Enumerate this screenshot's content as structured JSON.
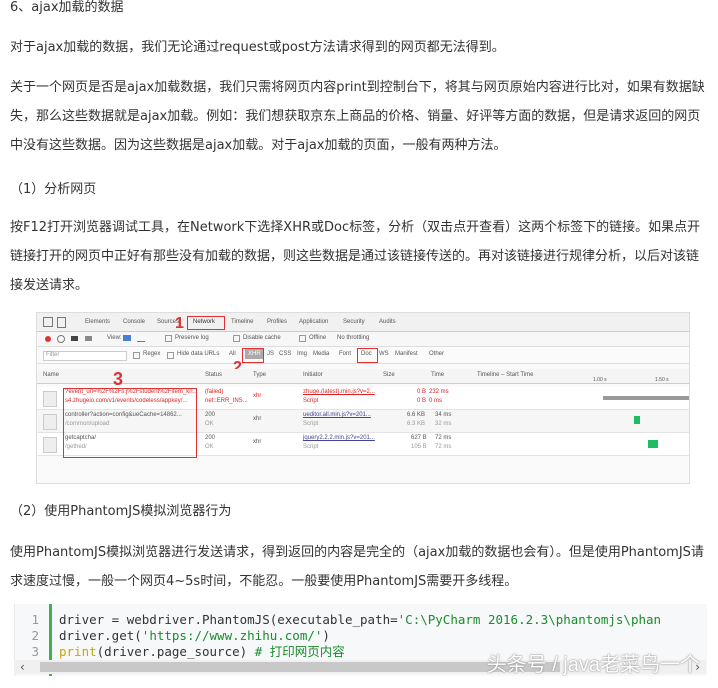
{
  "heading": "6、ajax加载的数据",
  "para1": "对于ajax加载的数据，我们无论通过request或post方法请求得到的网页都无法得到。",
  "para2": "关于一个网页是否是ajax加载数据，我们只需将网页内容print到控制台下，将其与网页原始内容进行比对，如果有数据缺失，那么这些数据就是ajax加载。例如：我们想获取京东上商品的价格、销量、好评等方面的数据，但是请求返回的网页中没有这些数据。因为这些数据是ajax加载。对于ajax加载的页面，一般有两种方法。",
  "para3": "（1）分析网页",
  "para4": "按F12打开浏览器调试工具，在Network下选择XHR或Doc标签，分析（双击点开查看）这两个标签下的链接。如果点开链接打开的网页中正好有那些没有加载的数据，则这些数据是通过该链接传送的。再对该链接进行规律分析，以后对该链接发送请求。",
  "para5": "（2）使用PhantomJS模拟浏览器行为",
  "para6": "使用PhantomJS模拟浏览器进行发送请求，得到返回的内容是完全的（ajax加载的数据也会有）。但是使用PhantomJS请求速度过慢，一般一个网页4~5s时间，不能忍。一般要使用PhantomJS需要开多线程。",
  "devtools": {
    "tabs": [
      "Elements",
      "Console",
      "Sources",
      "Network",
      "Timeline",
      "Profiles",
      "Application",
      "Security",
      "Audits"
    ],
    "toolbar": [
      "View:",
      "Preserve log",
      "Disable cache",
      "Offline",
      "No throttling"
    ],
    "filter_placeholder": "Filter",
    "filters": [
      "Regex",
      "Hide data URLs",
      "All",
      "XHR",
      "JS",
      "CSS",
      "Img",
      "Media",
      "Font",
      "Doc",
      "WS",
      "Manifest",
      "Other"
    ],
    "columns": [
      "Name",
      "Status",
      "Type",
      "Initiator",
      "Size",
      "Time",
      "Timeline – Start Time"
    ],
    "timeline_ticks": [
      "1.00 s",
      "1.50 s"
    ],
    "rows": [
      {
        "name": "?event_url=%2F%2Fs.j%2Fstudent%2Fitem_kn...",
        "path": "s4.zhugeio.com/v1/events/codeless/appkey/...",
        "status": "(failed)",
        "status2": "net::ERR_INS...",
        "type": "xhr",
        "initiator": "zhuge.(latest).min.js?v=2...",
        "initiator2": "Script",
        "size": "0 B",
        "size2": "0 B",
        "time": "232 ms",
        "time2": "0 ms"
      },
      {
        "name": "controller?action=config&ueCache=14862...",
        "path": "/common/upload",
        "status": "200",
        "status2": "OK",
        "type": "xhr",
        "initiator": "ueditor.all.min.js?v=201...",
        "initiator2": "Script",
        "size": "6.6 KB",
        "size2": "6.3 KB",
        "time": "34 ms",
        "time2": "32 ms"
      },
      {
        "name": "getcaptcha/",
        "path": "/gethed/",
        "status": "200",
        "status2": "OK",
        "type": "xhr",
        "initiator": "jquery2.2.2.min.js?v=201...",
        "initiator2": "Script",
        "size": "627 B",
        "size2": "105 B",
        "time": "72 ms",
        "time2": "72 ms"
      }
    ],
    "annotations": [
      "1",
      "2",
      "3"
    ]
  },
  "code": {
    "line_numbers": [
      "1",
      "2",
      "3"
    ],
    "line1_a": "driver = webdriver.PhantomJS(executable_path=",
    "line1_str": "'C:\\PyCharm 2016.2.3\\phantomjs\\phan",
    "line2_a": "driver.get(",
    "line2_str": "'https://www.zhihu.com/'",
    "line2_b": ")",
    "line3_kw": "print",
    "line3_a": "(driver.page_source) ",
    "line3_comment": "# 打印网页内容"
  },
  "scrollbar": {
    "left_arrow": "‹",
    "right_arrow": "›"
  },
  "watermark": "头条号 / java老菜鸟一个"
}
